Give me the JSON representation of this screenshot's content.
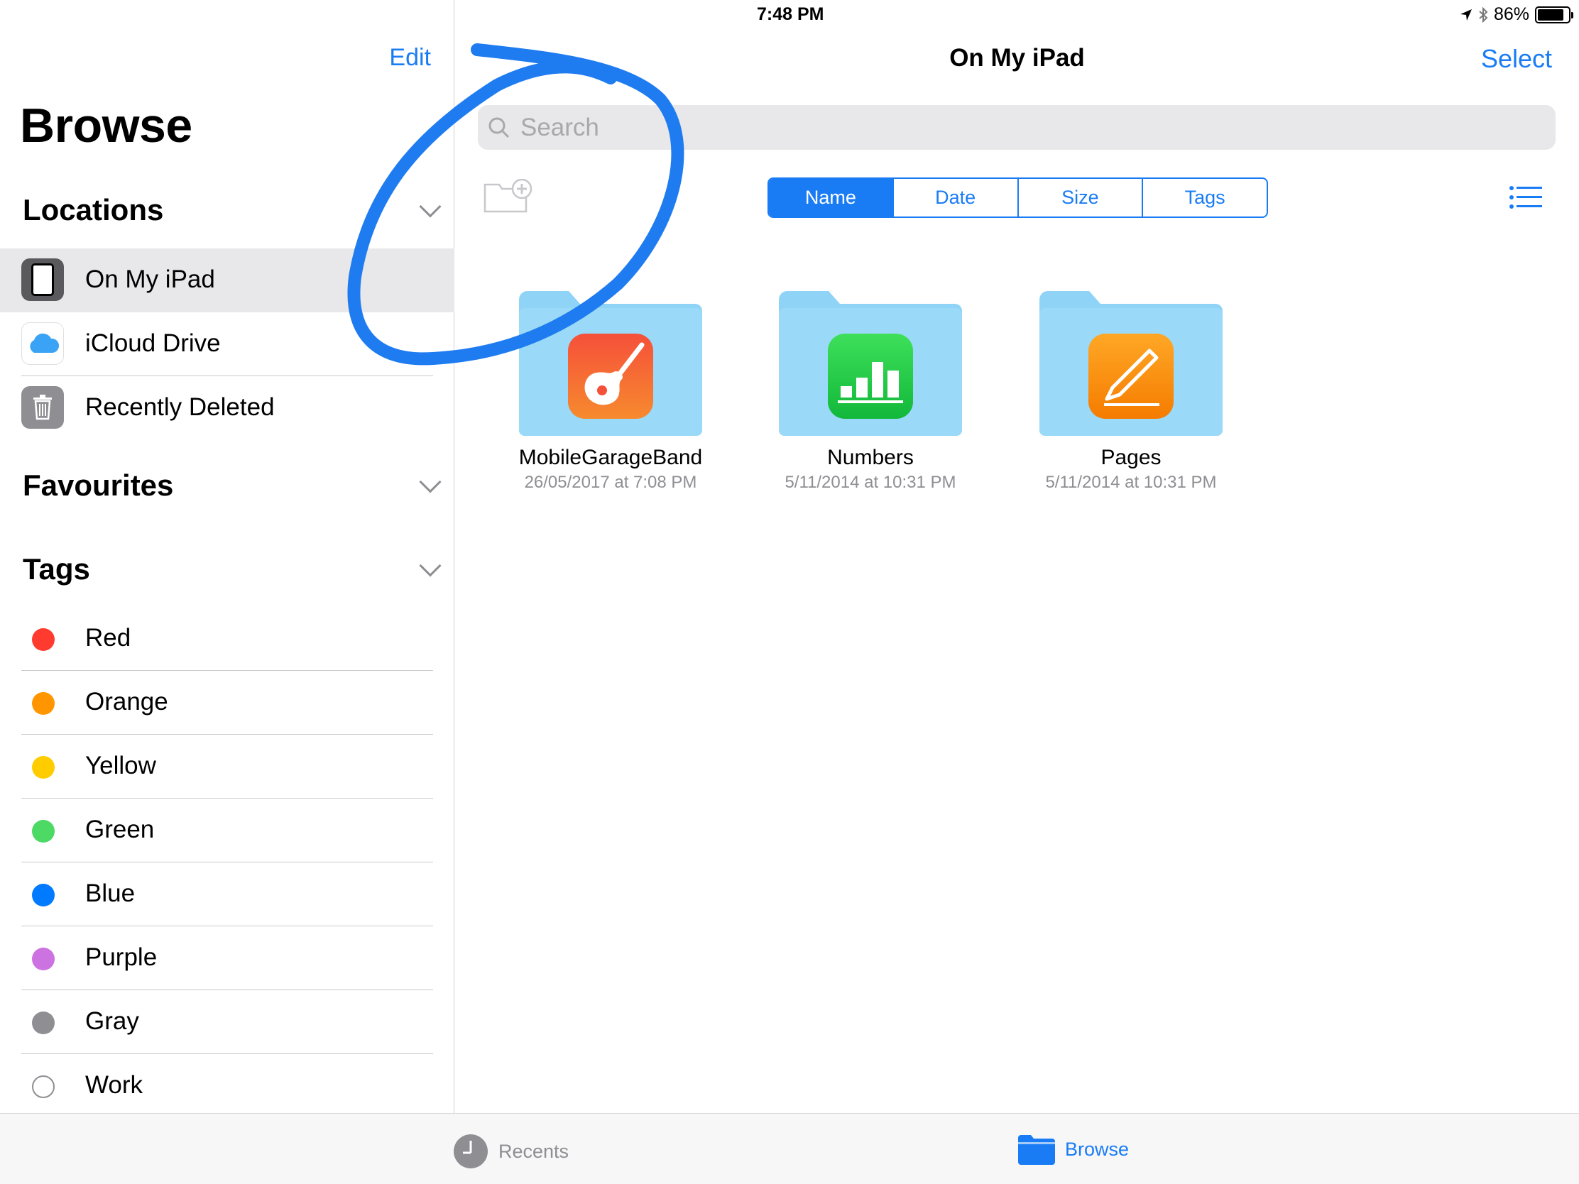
{
  "status_bar": {
    "device": "iPad",
    "time": "7:48 PM",
    "battery": "86%",
    "battery_level": 0.86
  },
  "sidebar": {
    "edit_label": "Edit",
    "title": "Browse",
    "locations_heading": "Locations",
    "locations": [
      {
        "label": "On My iPad",
        "icon": "ipad-icon",
        "selected": true
      },
      {
        "label": "iCloud Drive",
        "icon": "icloud-icon"
      },
      {
        "label": "Recently Deleted",
        "icon": "trash-icon"
      }
    ],
    "favourites_heading": "Favourites",
    "tags_heading": "Tags",
    "tags": [
      {
        "label": "Red",
        "color": "#ff3b30"
      },
      {
        "label": "Orange",
        "color": "#ff9500"
      },
      {
        "label": "Yellow",
        "color": "#ffcc00"
      },
      {
        "label": "Green",
        "color": "#4cd964"
      },
      {
        "label": "Blue",
        "color": "#007aff"
      },
      {
        "label": "Purple",
        "color": "#cc73e1"
      },
      {
        "label": "Gray",
        "color": "#8e8e93"
      },
      {
        "label": "Work",
        "color": ""
      }
    ]
  },
  "main": {
    "title": "On My iPad",
    "select_label": "Select",
    "search_placeholder": "Search",
    "sort_options": [
      "Name",
      "Date",
      "Size",
      "Tags"
    ],
    "sort_active": "Name",
    "files": [
      {
        "name": "MobileGarageBand",
        "date": "26/05/2017 at 7:08 PM",
        "icon": "garageband-icon"
      },
      {
        "name": "Numbers",
        "date": "5/11/2014 at 10:31 PM",
        "icon": "numbers-icon"
      },
      {
        "name": "Pages",
        "date": "5/11/2014 at 10:31 PM",
        "icon": "pages-icon"
      }
    ]
  },
  "tab_bar": {
    "recents_label": "Recents",
    "browse_label": "Browse",
    "active": "Browse"
  },
  "colors": {
    "accent": "#1a7cf5",
    "folder": "#8fd3f7",
    "annotation": "#1f7cf0"
  }
}
